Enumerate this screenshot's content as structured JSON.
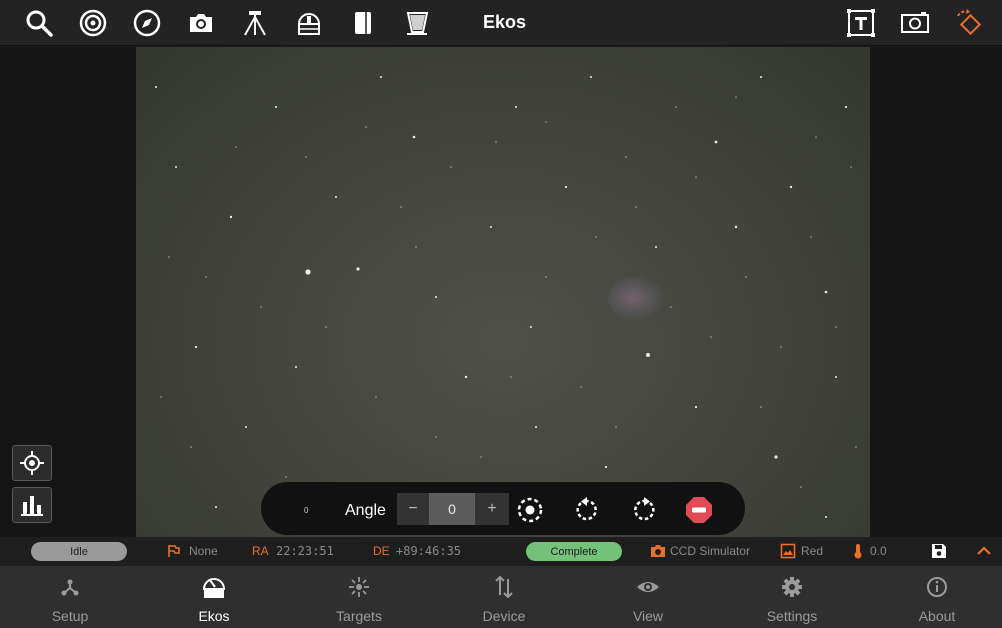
{
  "app": {
    "title": "Ekos"
  },
  "toolbar": {
    "left_icons": [
      "search-icon",
      "target-icon",
      "compass-icon",
      "camera-icon",
      "tripod-icon",
      "dome-icon",
      "notebook-icon",
      "flat-panel-icon"
    ],
    "right_icons": [
      "text-frame-icon",
      "capture-frame-icon",
      "rotate-diamond-icon"
    ],
    "accent": "#e8702a"
  },
  "viewer": {
    "side_buttons": [
      "crosshair-icon",
      "histogram-icon"
    ],
    "rotation": {
      "small_value": "0",
      "angle_label": "Angle",
      "minus": "−",
      "value": "0",
      "plus": "+"
    }
  },
  "status": {
    "mount_state": "Idle",
    "tracking": "None",
    "ra_label": "RA",
    "ra_value": "22:23:51",
    "de_label": "DE",
    "de_value": "+89:46:35",
    "capture_state": "Complete",
    "camera": "CCD Simulator",
    "filter": "Red",
    "temperature": "0.0"
  },
  "nav": {
    "items": [
      {
        "label": "Setup",
        "icon": "setup-icon"
      },
      {
        "label": "Ekos",
        "icon": "ekos-icon"
      },
      {
        "label": "Targets",
        "icon": "targets-icon"
      },
      {
        "label": "Device",
        "icon": "device-icon"
      },
      {
        "label": "View",
        "icon": "eye-icon"
      },
      {
        "label": "Settings",
        "icon": "gear-icon"
      },
      {
        "label": "About",
        "icon": "info-icon"
      }
    ],
    "active": "Ekos"
  },
  "colors": {
    "idle_badge": "#9a9a9a",
    "complete_badge": "#74c17a",
    "stop_button": "#e04b57"
  }
}
